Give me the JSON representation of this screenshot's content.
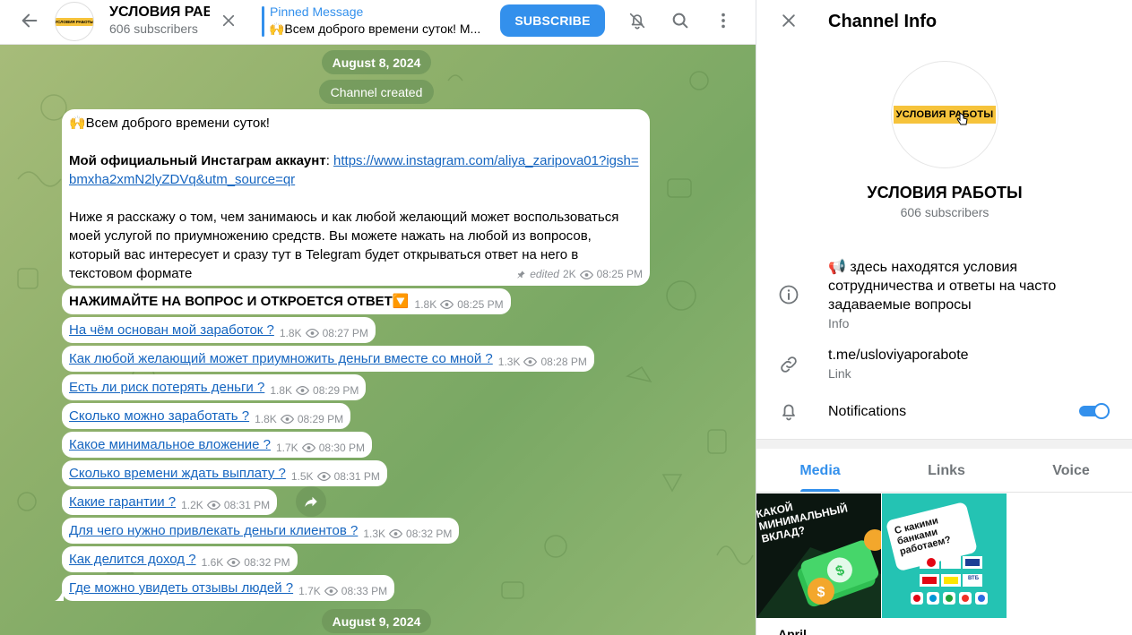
{
  "header": {
    "title": "УСЛОВИЯ РАБОТЫ",
    "subscribers": "606 subscribers",
    "avatar_text": "УСЛОВИЯ РАБОТЫ",
    "pinned_label": "Pinned Message",
    "pinned_text": "🙌Всем доброго времени суток! М...",
    "subscribe_label": "SUBSCRIBE"
  },
  "chat": {
    "date1": "August 8, 2024",
    "channel_created": "Channel created",
    "date2": "August 9, 2024",
    "main_message": {
      "greeting": "🙌Всем доброго времени суток!",
      "insta_label": "Мой официальный Инстаграм аккаунт",
      "insta_colon": ": ",
      "insta_link": "https://www.instagram.com/aliya_zaripova01?igsh=bmxha2xmN2lyZDVq&utm_source=qr",
      "body": "Ниже я расскажу о том, чем занимаюсь и как любой желающий может воспользоваться моей услугой по приумножению средств. Вы можете нажать на любой из вопросов, который вас интересует и сразу тут в Telegram будет открываться ответ на него в текстовом формате",
      "edited": "edited",
      "views": "2K",
      "time": "08:25 PM"
    },
    "heading_message": {
      "text": "НАЖИМАЙТЕ НА ВОПРОС И ОТКРОЕТСЯ ОТВЕТ🔽",
      "views": "1.8K",
      "time": "08:25 PM"
    },
    "questions": [
      {
        "text": "На чём основан мой заработок ?",
        "views": "1.8K",
        "time": "08:27 PM"
      },
      {
        "text": "Как любой желающий может приумножить деньги вместе со мной ?",
        "views": "1.3K",
        "time": "08:28 PM"
      },
      {
        "text": "Есть ли риск потерять деньги ?",
        "views": "1.8K",
        "time": "08:29 PM"
      },
      {
        "text": "Сколько можно заработать ?",
        "views": "1.8K",
        "time": "08:29 PM"
      },
      {
        "text": "Какое минимальное вложение ?",
        "views": "1.7K",
        "time": "08:30 PM"
      },
      {
        "text": "Сколько времени ждать выплату ?",
        "views": "1.5K",
        "time": "08:31 PM"
      },
      {
        "text": "Какие гарантии ?",
        "views": "1.2K",
        "time": "08:31 PM"
      },
      {
        "text": "Для чего нужно привлекать деньги клиентов ?",
        "views": "1.3K",
        "time": "08:32 PM"
      },
      {
        "text": "Как делится доход ?",
        "views": "1.6K",
        "time": "08:32 PM"
      },
      {
        "text": "Где можно увидеть отзывы людей ?",
        "views": "1.7K",
        "time": "08:33 PM"
      }
    ]
  },
  "info": {
    "title": "Channel Info",
    "avatar_text": "УСЛОВИЯ РАБОТЫ",
    "name": "УСЛОВИЯ РАБОТЫ",
    "subscribers": "606 subscribers",
    "description": "📢 здесь находятся условия сотрудничества и ответы на часто задаваемые вопросы",
    "description_label": "Info",
    "link": "t.me/usloviyaporabote",
    "link_label": "Link",
    "notifications_label": "Notifications",
    "notifications_on": true,
    "tabs": [
      "Media",
      "Links",
      "Voice"
    ],
    "active_tab": "Media",
    "thumb1_text": "КАКОЙ МИНИМАЛЬНЫЙ ВКЛАД?",
    "thumb2_text": "С какими банками работаем?",
    "thumb2_bank": "ВТБ",
    "month_label": "April"
  },
  "colors": {
    "accent": "#3390ec",
    "logo_yellow": "#f6c33b",
    "link": "#1565c0",
    "muted": "#707579"
  }
}
